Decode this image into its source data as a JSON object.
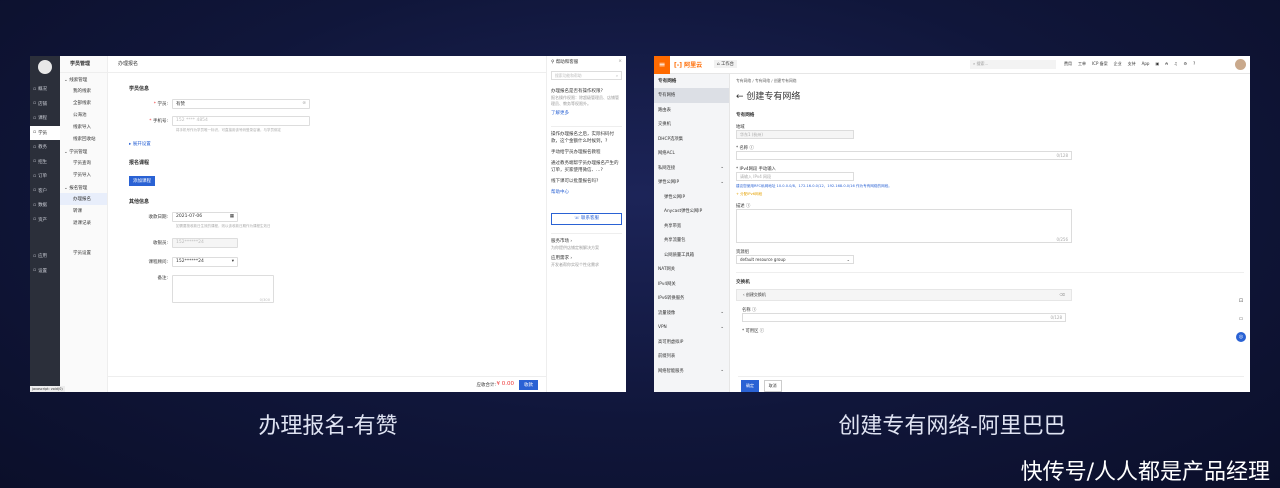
{
  "left": {
    "caption": "办理报名-有赞",
    "sidebar": [
      "概况",
      "店铺",
      "课程",
      "学员",
      "教务",
      "招生",
      "订单",
      "客户",
      "数据",
      "资产",
      "应用",
      "设置"
    ],
    "active_side": "学员",
    "sub_title": "学员管理",
    "sub_groups": [
      {
        "title": "线索管理",
        "items": [
          "我的线索",
          "全部线索",
          "公海池",
          "线索导入",
          "线索回收站"
        ]
      },
      {
        "title": "学员管理",
        "items": [
          "学员查询",
          "学员导入"
        ]
      },
      {
        "title": "报名管理",
        "items": [
          "办理报名",
          "转课",
          "退课记录"
        ]
      },
      {
        "title": "",
        "items": [
          "学员设置"
        ]
      }
    ],
    "active_sub": "办理报名",
    "page_title": "办理报名",
    "student_section": "学员信息",
    "student_label": "学员:",
    "student_value": "有赞",
    "phone_label": "手机号:",
    "phone_value": "152 **** 4854",
    "phone_help": "将手机号作为学员唯一标识，可直接用该号码登录店铺，与学员绑定",
    "more_settings": "展开设置",
    "course_section": "报名课程",
    "add_course": "添加课程",
    "other_section": "其他信息",
    "date_label": "收款日期:",
    "date_value": "2021-07-06",
    "date_help": "如需要按收款日生效的课程，则以该收款日期作为课程生效日",
    "payee_label": "收银员:",
    "payee_value": "152******24",
    "consultant_label": "课程顾问:",
    "consultant_value": "152******24",
    "remark_label": "备注:",
    "remark_count": "0/300",
    "total_label": "应收合计:",
    "total_value": "¥ 0.00",
    "submit": "收款",
    "help_title": "帮助和客服",
    "help_search": "搜索功能和帮助",
    "help_q1": "办理报名是否有操作权限?",
    "help_a1": "报名操作权限：除超级管理员、店铺管理员、教务等权限外。",
    "help_more": "了解更多",
    "help_q2": "操作办理报名之后，实际扫码付款，这个金额什么时候到，?",
    "help_q3": "手动给学员办理报名教程",
    "help_q4": "通过教务端帮学员办理报名产生的订单，买家使用微信、…?",
    "help_q5": "线下课可以批量报名吗?",
    "help_center": "帮助中心",
    "contact": "联系客服",
    "service_title": "服务市场 ›",
    "service_desc": "为你提供店铺定制解决方案",
    "app_title": "应用需求 ›",
    "app_desc": "开发者帮你实现个性化需求",
    "status_bar": "javascript: void(0)"
  },
  "right": {
    "caption": "创建专有网络-阿里巴巴",
    "logo": "阿里云",
    "workbench": "工作台",
    "search": "搜索...",
    "top_links": [
      "费用",
      "工单",
      "ICP 备案",
      "企业",
      "支持",
      "App"
    ],
    "side_title": "专有网络",
    "side_items": [
      "专有网络",
      "路由表",
      "交换机",
      "DHCP选项集",
      "网络ACL",
      "私网连接",
      "弹性公网IP",
      "弹性公网IP",
      "Anycast弹性公网IP",
      "共享带宽",
      "共享流量包",
      "公网质量工具箱",
      "NAT网关",
      "IPv4网关",
      "IPv6转换服务",
      "流量镜像",
      "VPN",
      "高可用虚拟IP",
      "前缀列表",
      "网络智能服务"
    ],
    "breadcrumb": "专有网络 / 专有网络 / 创建专有网络",
    "page_title": "创建专有网络",
    "vpc_section": "专有网络",
    "region_label": "地域",
    "region_value": "华东1 (杭州)",
    "name_label": "* 名称 ⓘ",
    "name_count": "0/128",
    "cidr_label": "* IPv4网段  手动输入",
    "cidr_placeholder": "请输入 IPv4 网段",
    "cidr_hint": "建议您使用RFC私网地址 10.0.0.0/8、172.16.0.0/12、192.168.0.0/16 作为专有网络的网段。",
    "ipv6_hint": "+ 分配IPv6网段",
    "desc_label": "描述 ⓘ",
    "desc_count": "0/256",
    "rg_label": "资源组",
    "rg_value": "default resource group",
    "switch_section": "交换机",
    "switch_item": "创建交换机",
    "switch_name": "名称 ⓘ",
    "switch_count": "0/128",
    "zone_label": "* 可用区 ⓘ",
    "ok": "确定",
    "cancel": "取消"
  },
  "watermark": "快传号/人人都是产品经理"
}
